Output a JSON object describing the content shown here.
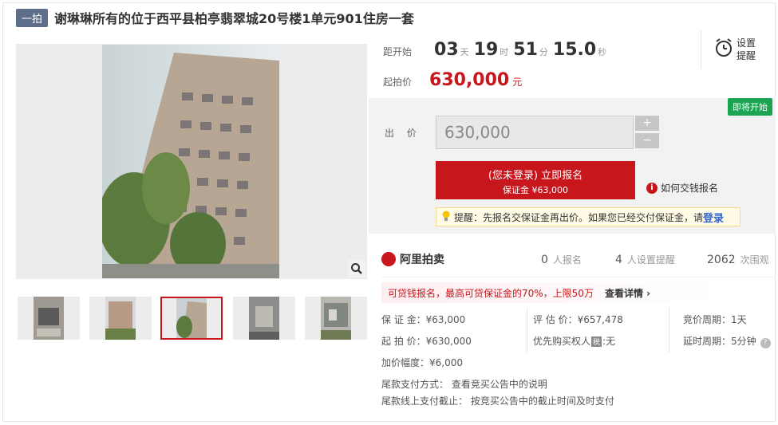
{
  "header": {
    "tag": "一拍",
    "title": "谢琳琳所有的位于西平县柏亭翡翠城20号楼1单元901住房一套"
  },
  "countdown": {
    "label": "距开始",
    "days": "03",
    "days_unit": "天",
    "hours": "19",
    "hours_unit": "时",
    "minutes": "51",
    "minutes_unit": "分",
    "seconds": "15.0",
    "seconds_unit": "秒"
  },
  "reminder": {
    "label": "设置提醒",
    "icon": "alarm-clock-icon"
  },
  "start_price": {
    "label": "起拍价",
    "value": "630,000",
    "unit": "元"
  },
  "status_badge": "即将开始",
  "bid": {
    "label": "出 价",
    "placeholder": "630,000",
    "plus": "+",
    "minus": "−"
  },
  "signup": {
    "line1": "(您未登录) 立即报名",
    "line2": "保证金 ¥63,000"
  },
  "howto_link": "如何交钱报名",
  "tip": {
    "prefix": "提醒：先报名交保证金再出价。如果您已经交付保证金，请",
    "login": "登录"
  },
  "ali": {
    "brand": "阿里拍卖",
    "signups": {
      "count": "0",
      "label": "人报名"
    },
    "reminders": {
      "count": "4",
      "label": "人设置提醒"
    },
    "views": {
      "count": "2062",
      "label": "次围观"
    }
  },
  "loan": {
    "text": "可贷钱报名，最高可贷保证金的70%，上限50万",
    "more": "查看详情 ›"
  },
  "details": {
    "deposit": "保 证 金：¥63,000",
    "start": "起 拍 价：¥630,000",
    "increment": "加价幅度：¥6,000",
    "appraisal": "评 估 价：¥657,478",
    "priority_prefix": "优先购买权人",
    "priority_tax": "税",
    "priority_value": ":无",
    "cycle": "竞价周期：1天",
    "delay": "延时周期：5分钟",
    "final_payment": "尾款支付方式： 查看竞买公告中的说明",
    "final_deadline": "尾款线上支付截止： 按竞买公告中的截止时间及时支付"
  },
  "colors": {
    "accent": "#c8161d",
    "tag": "#5c6e8a",
    "badge": "#1ba552"
  }
}
